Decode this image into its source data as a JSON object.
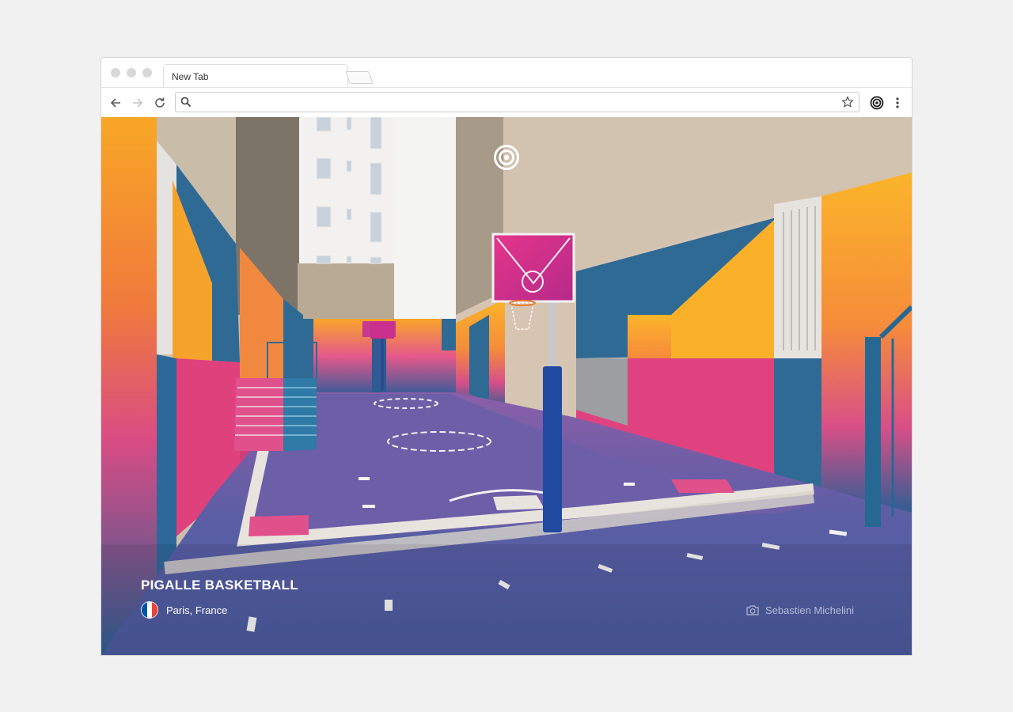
{
  "browser": {
    "tab": {
      "label": "New Tab"
    },
    "omnibox": {
      "value": "",
      "placeholder": ""
    },
    "icons": {
      "back": "arrow-left-icon",
      "forward": "arrow-right-icon",
      "reload": "reload-icon",
      "search": "search-icon",
      "bookmark": "star-icon",
      "extension": "target-rings-icon",
      "menu": "more-vertical-icon"
    }
  },
  "photo": {
    "title": "PIGALLE BASKETBALL",
    "location": "Paris, France",
    "photographer": "Sebastien Michelini",
    "flag": {
      "colors": [
        "#0055a4",
        "#ffffff",
        "#ef4135"
      ]
    }
  },
  "colors": {
    "page_background": "#f1f1f1",
    "court_blue": "#4a5b9a",
    "wall_orange": "#f7a429",
    "wall_pink": "#e2467a",
    "wall_teal": "#2d6a93"
  }
}
